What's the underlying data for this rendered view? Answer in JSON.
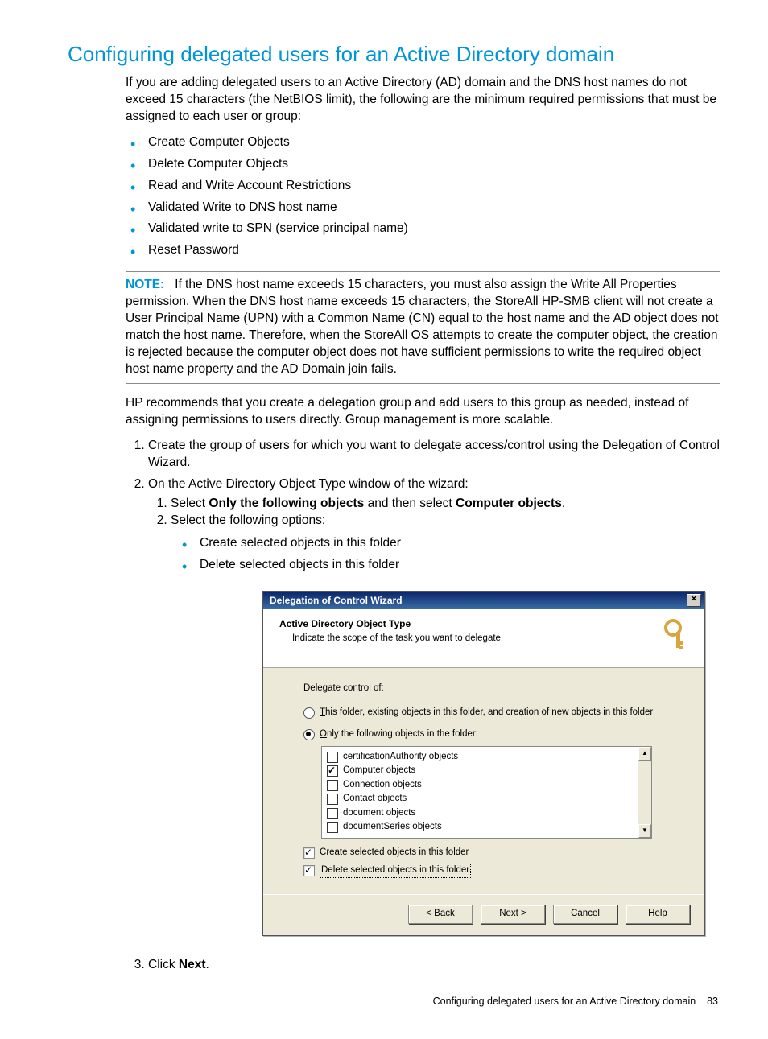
{
  "heading": "Configuring delegated users for an Active Directory domain",
  "intro": "If you are adding delegated users to an Active Directory (AD) domain and the DNS host names do not exceed 15 characters (the NetBIOS limit), the following are the minimum required permissions that must be assigned to each user or group:",
  "permissions": [
    "Create Computer Objects",
    "Delete Computer Objects",
    "Read and Write Account Restrictions",
    "Validated Write to DNS host name",
    "Validated write to SPN (service principal name)",
    "Reset Password"
  ],
  "note_label": "NOTE:",
  "note_text": "If the DNS host name exceeds 15 characters, you must also assign the Write All Properties permission. When the DNS host name exceeds 15 characters, the StoreAll HP-SMB client will not create a User Principal Name (UPN) with a Common Name (CN) equal to the host name and the AD object does not match the host name. Therefore, when the StoreAll OS attempts to create the computer object, the creation is rejected because the computer object does not have sufficient permissions to write the required object host name property and the AD Domain join fails.",
  "recommend": "HP recommends that you create a delegation group and add users to this group as needed, instead of assigning permissions to users directly. Group management is more scalable.",
  "steps": {
    "s1": "Create the group of users for which you want to delegate access/control using the Delegation of Control Wizard.",
    "s2": "On the Active Directory Object Type window of the wizard:",
    "s2_1_pre": "Select ",
    "s2_1_b1": "Only the following objects",
    "s2_1_mid": " and then select ",
    "s2_1_b2": "Computer objects",
    "s2_1_post": ".",
    "s2_2": "Select the following options:",
    "s2_bullets": [
      "Create selected objects in this folder",
      "Delete selected objects in this folder"
    ],
    "s3_pre": "Click ",
    "s3_b": "Next",
    "s3_post": "."
  },
  "dialog": {
    "title": "Delegation of Control Wizard",
    "header_title": "Active Directory Object Type",
    "header_sub": "Indicate the scope of the task you want to delegate.",
    "delegate_label": "Delegate control of:",
    "radio1_pre": "T",
    "radio1_rest": "his folder, existing objects in this folder, and creation of new objects in this folder",
    "radio2_pre": "O",
    "radio2_rest": "nly the following objects in the folder:",
    "list_items": [
      {
        "label": "certificationAuthority objects",
        "checked": false
      },
      {
        "label": "Computer objects",
        "checked": true
      },
      {
        "label": "Connection objects",
        "checked": false
      },
      {
        "label": "Contact objects",
        "checked": false
      },
      {
        "label": "document objects",
        "checked": false
      },
      {
        "label": "documentSeries objects",
        "checked": false
      }
    ],
    "chk_create_pre": "C",
    "chk_create_rest": "reate selected objects in this folder",
    "chk_delete": "Delete selected objects in this folder",
    "btn_back_pre": "< ",
    "btn_back_u": "B",
    "btn_back_rest": "ack",
    "btn_next_u": "N",
    "btn_next_rest": "ext >",
    "btn_cancel": "Cancel",
    "btn_help": "Help"
  },
  "footer_text": "Configuring delegated users for an Active Directory domain",
  "footer_page": "83"
}
